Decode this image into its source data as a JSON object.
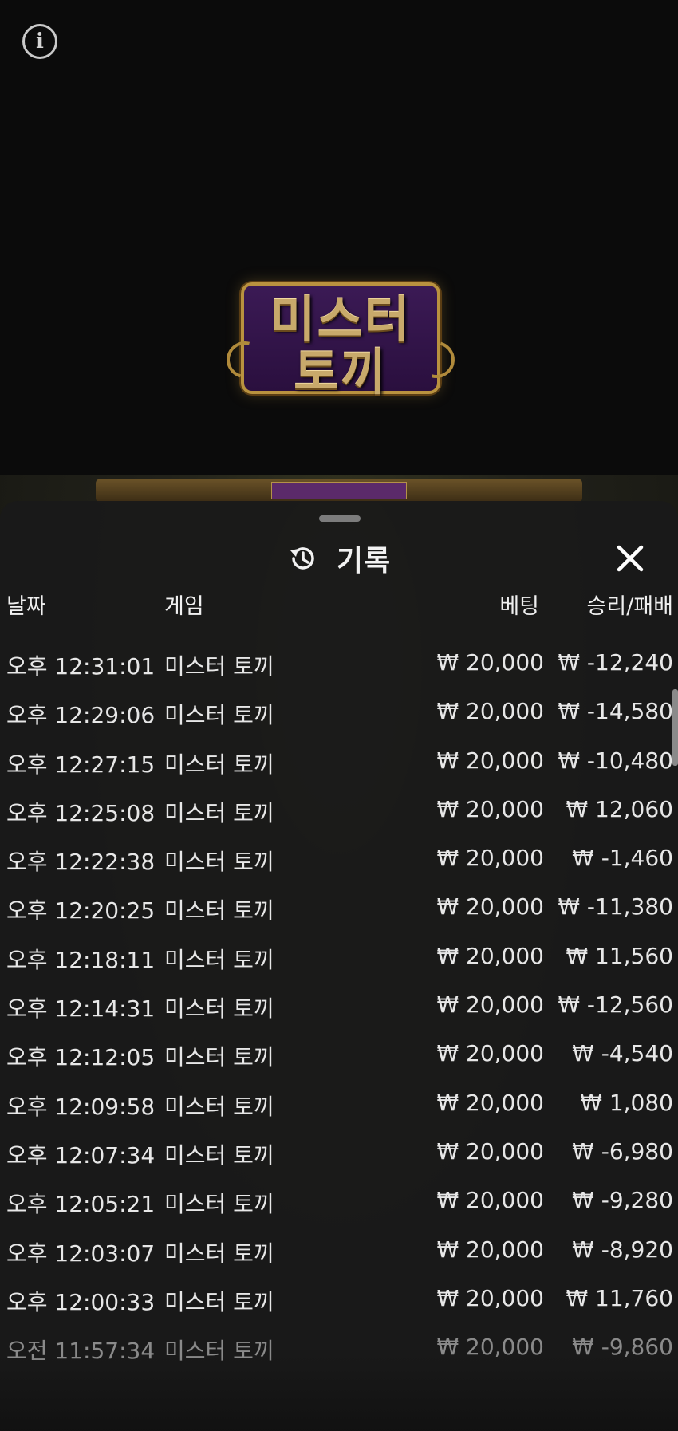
{
  "top": {
    "info_icon": "info-icon",
    "logo_line1": "미스터",
    "logo_line2": "토끼"
  },
  "panel": {
    "title": "기록",
    "history_icon": "history-icon",
    "close_icon": "close-icon",
    "columns": {
      "date": "날짜",
      "game": "게임",
      "bet": "베팅",
      "win_loss": "승리/패배"
    },
    "rows": [
      {
        "time": "오후 12:31:01",
        "game": "미스터 토끼",
        "bet": "₩ 20,000",
        "result": "₩ -12,240"
      },
      {
        "time": "오후 12:29:06",
        "game": "미스터 토끼",
        "bet": "₩ 20,000",
        "result": "₩ -14,580"
      },
      {
        "time": "오후 12:27:15",
        "game": "미스터 토끼",
        "bet": "₩ 20,000",
        "result": "₩ -10,480"
      },
      {
        "time": "오후 12:25:08",
        "game": "미스터 토끼",
        "bet": "₩ 20,000",
        "result": "₩ 12,060"
      },
      {
        "time": "오후 12:22:38",
        "game": "미스터 토끼",
        "bet": "₩ 20,000",
        "result": "₩ -1,460"
      },
      {
        "time": "오후 12:20:25",
        "game": "미스터 토끼",
        "bet": "₩ 20,000",
        "result": "₩ -11,380"
      },
      {
        "time": "오후 12:18:11",
        "game": "미스터 토끼",
        "bet": "₩ 20,000",
        "result": "₩ 11,560"
      },
      {
        "time": "오후 12:14:31",
        "game": "미스터 토끼",
        "bet": "₩ 20,000",
        "result": "₩ -12,560"
      },
      {
        "time": "오후 12:12:05",
        "game": "미스터 토끼",
        "bet": "₩ 20,000",
        "result": "₩ -4,540"
      },
      {
        "time": "오후 12:09:58",
        "game": "미스터 토끼",
        "bet": "₩ 20,000",
        "result": "₩ 1,080"
      },
      {
        "time": "오후 12:07:34",
        "game": "미스터 토끼",
        "bet": "₩ 20,000",
        "result": "₩ -6,980"
      },
      {
        "time": "오후 12:05:21",
        "game": "미스터 토끼",
        "bet": "₩ 20,000",
        "result": "₩ -9,280"
      },
      {
        "time": "오후 12:03:07",
        "game": "미스터 토끼",
        "bet": "₩ 20,000",
        "result": "₩ -8,920"
      },
      {
        "time": "오후 12:00:33",
        "game": "미스터 토끼",
        "bet": "₩ 20,000",
        "result": "₩ 11,760"
      },
      {
        "time": "오전 11:57:34",
        "game": "미스터 토끼",
        "bet": "₩ 20,000",
        "result": "₩ -9,860"
      }
    ]
  },
  "colors": {
    "panel_bg": "#1a1a1a",
    "logo_purple": "#3b1a55",
    "logo_gold": "#b9923f"
  }
}
